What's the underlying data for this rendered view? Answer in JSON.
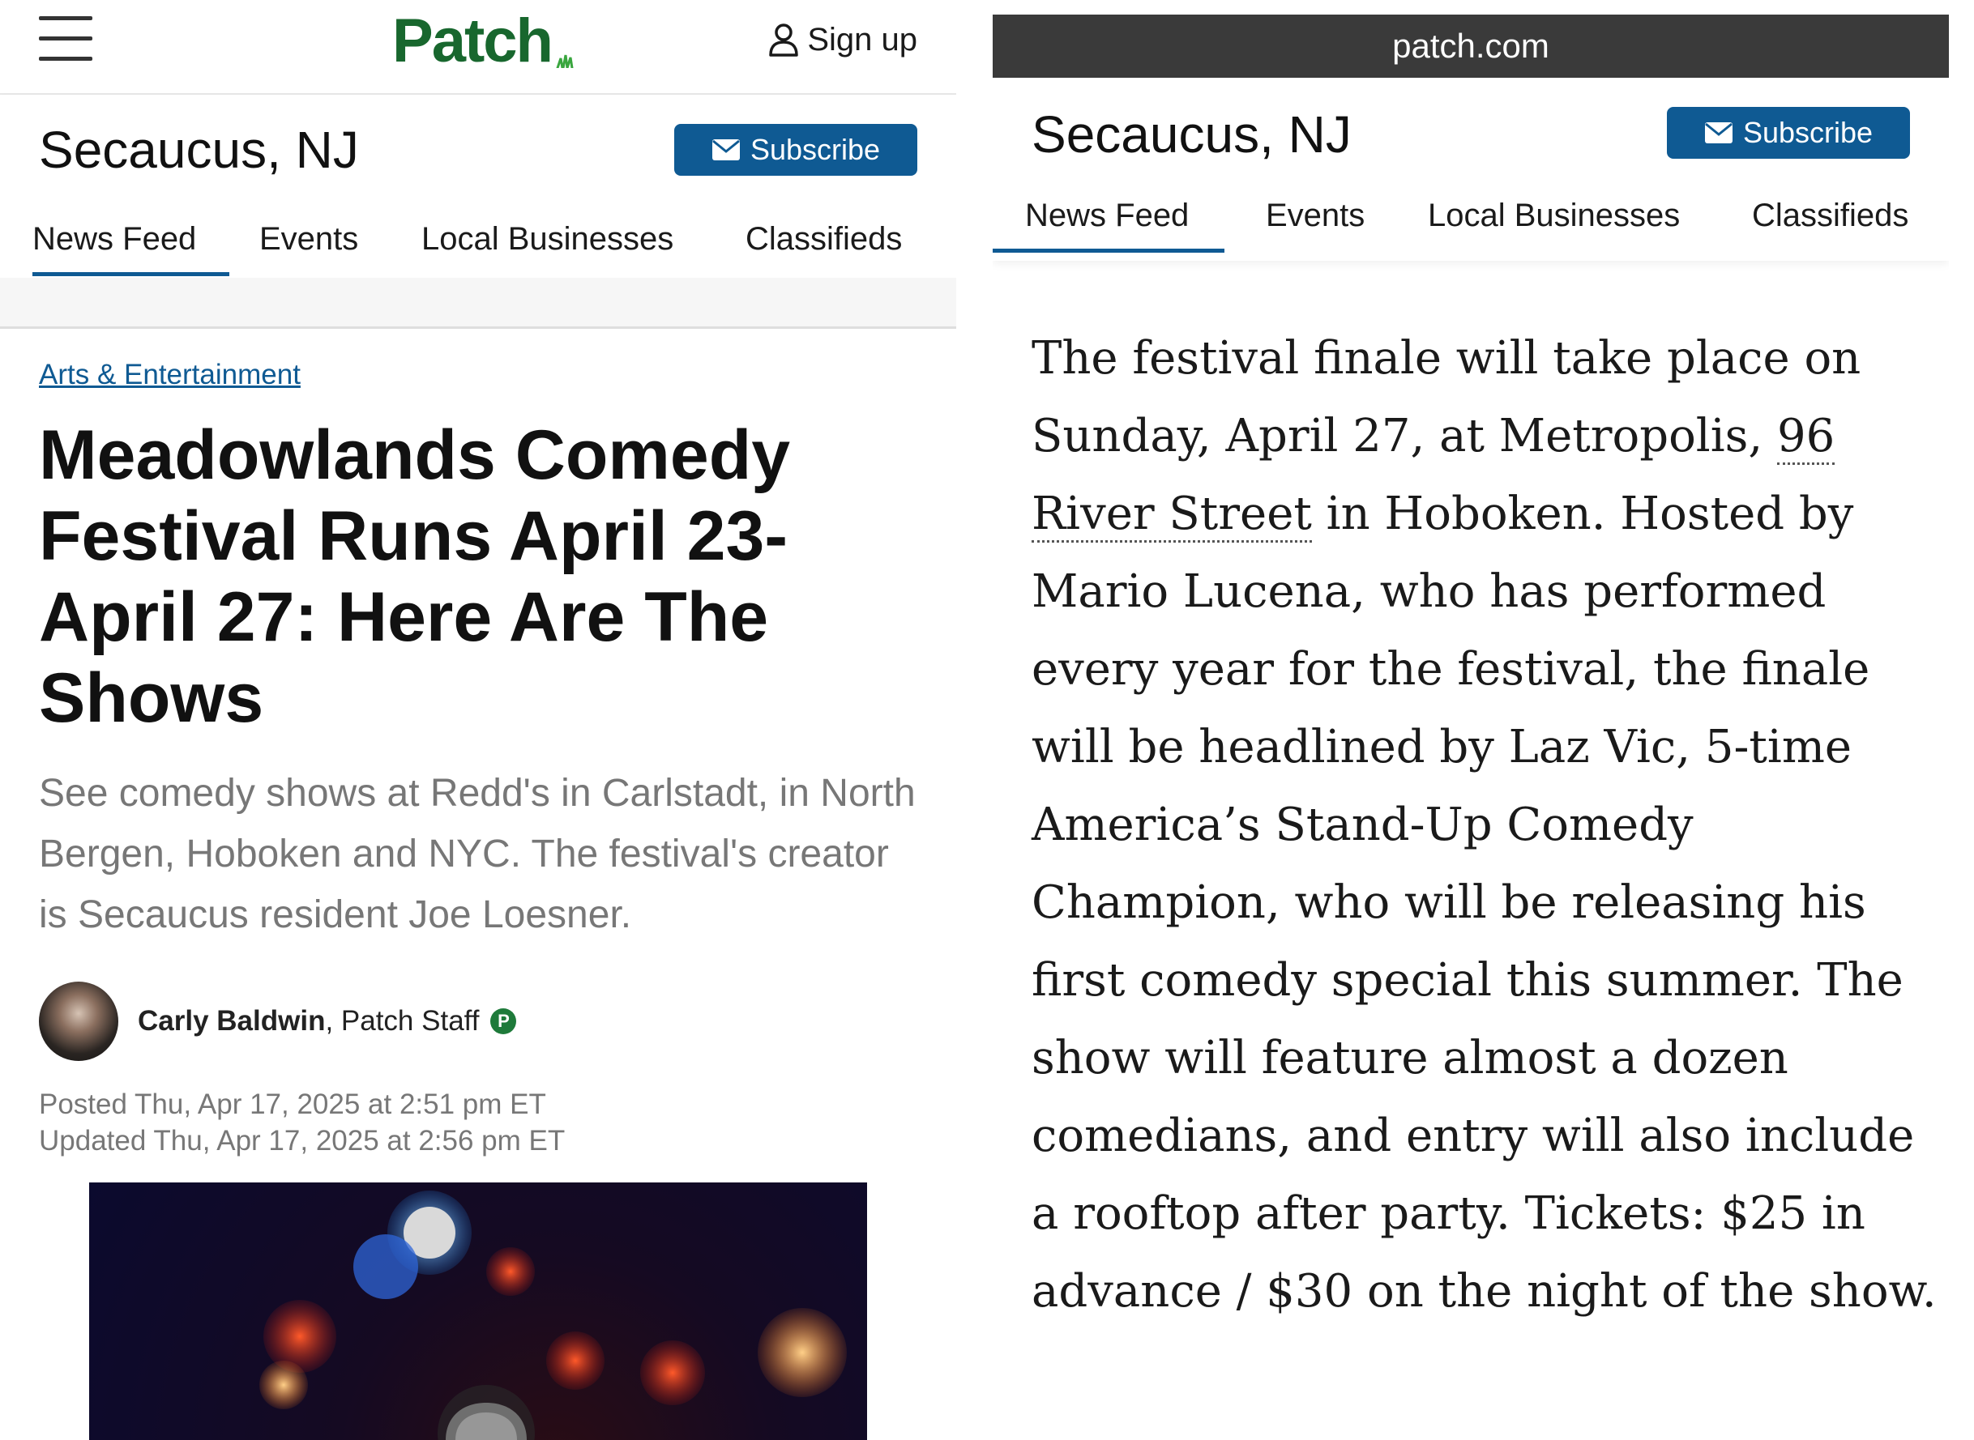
{
  "left": {
    "logo": "Patch",
    "signup": "Sign up",
    "city": "Secaucus, NJ",
    "subscribe": "Subscribe",
    "tabs": [
      "News Feed",
      "Events",
      "Local Businesses",
      "Classifieds"
    ],
    "category": "Arts & Entertainment",
    "headline": "Meadowlands Comedy Festival Runs April 23-April 27: Here Are The Shows",
    "deck": "See comedy shows at Redd's in Carlstadt, in North Bergen, Hoboken and NYC. The festival's creator is Secaucus resident Joe Loesner.",
    "author_name": "Carly Baldwin",
    "author_role": ", Patch Staff",
    "badge": "P",
    "posted": "Posted Thu, Apr 17, 2025 at 2:51 pm ET",
    "updated": "Updated Thu, Apr 17, 2025 at 2:56 pm ET"
  },
  "right": {
    "url": "patch.com",
    "city": "Secaucus, NJ",
    "subscribe": "Subscribe",
    "tabs": [
      "News Feed",
      "Events",
      "Local Businesses",
      "Classifieds"
    ],
    "body_before": "The festival finale will take place on Sunday, April 27, at Metropolis, ",
    "body_link": "96 River Street",
    "body_after": " in Hoboken. Hosted by Mario Lucena, who has performed every year for the festival, the finale will be headlined by Laz Vic, 5-time America’s Stand-Up Comedy Champion, who will be releasing his first comedy special this summer. The show will feature almost a dozen comedians, and entry will also include a rooftop after party. Tickets: $25 in advance / $30 on the night of the show."
  },
  "colors": {
    "brand_green": "#18672e",
    "accent_blue": "#0f5a93",
    "muted_text": "#777777",
    "url_bar": "#3a3a3a"
  },
  "icons": {
    "menu": "hamburger-icon",
    "user": "user-icon",
    "mail": "mail-icon",
    "verified": "patch-badge-icon"
  }
}
